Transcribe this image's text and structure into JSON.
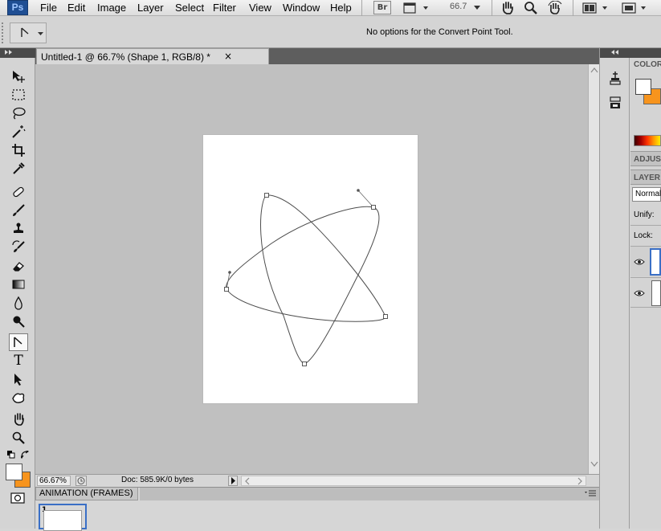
{
  "menubar": {
    "logo": "Ps",
    "items": [
      "File",
      "Edit",
      "Image",
      "Layer",
      "Select",
      "Filter",
      "View",
      "Window",
      "Help"
    ],
    "bridge_label": "Br",
    "zoom_value": "66.7"
  },
  "options_bar": {
    "message": "No options for the Convert Point Tool."
  },
  "document_tab": {
    "title": "Untitled-1 @ 66.7% (Shape 1, RGB/8) *",
    "close": "×"
  },
  "toolbox": {
    "tools": [
      "move-tool",
      "marquee-tool",
      "lasso-tool",
      "magic-wand-tool",
      "crop-tool",
      "eyedropper-tool",
      "healing-brush-tool",
      "brush-tool",
      "clone-stamp-tool",
      "history-brush-tool",
      "eraser-tool",
      "gradient-tool",
      "blur-tool",
      "dodge-tool",
      "convert-point-tool",
      "type-tool",
      "path-selection-tool",
      "custom-shape-tool",
      "hand-tool",
      "zoom-tool"
    ],
    "active_tool": "convert-point-tool",
    "type_glyph": "T",
    "foreground_color": "#ffffff",
    "background_color": "#f7941d"
  },
  "status_bar": {
    "zoom": "66.67%",
    "doc_info": "Doc: 585.9K/0 bytes"
  },
  "animation_panel": {
    "title": "ANIMATION (FRAMES)",
    "frames": [
      {
        "number": "1"
      }
    ]
  },
  "right_panels": {
    "color_label": "COLOR",
    "adjustments_label": "ADJUS",
    "layers_label": "LAYER",
    "blend_mode": "Normal",
    "unify_label": "Unify:",
    "lock_label": "Lock:",
    "swatch_fg": "#ffffff",
    "swatch_bg": "#f7941d"
  }
}
